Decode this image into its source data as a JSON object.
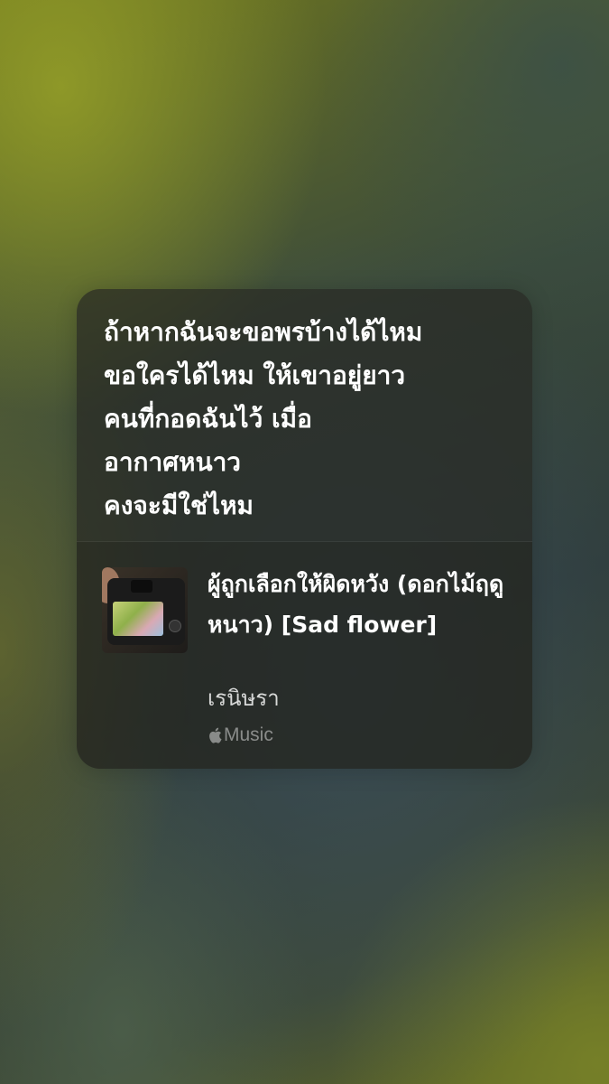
{
  "lyrics": {
    "lines": [
      "ถ้าหากฉันจะขอพรบ้างได้ไหม",
      "ขอใครได้ไหม ให้เขาอยู่ยาว",
      "คนที่กอดฉันไว้ เมื่อ",
      "อากาศหนาว",
      "คงจะมีใช่ไหม"
    ]
  },
  "song": {
    "title": "ผู้ถูกเลือกให้ผิดหวัง (ดอกไม้ฤดูหนาว) [Sad flower]",
    "artist": "เรนิษรา",
    "service_label": "Music",
    "service_icon": "apple-icon",
    "artwork_icon": "camera-artwork"
  }
}
